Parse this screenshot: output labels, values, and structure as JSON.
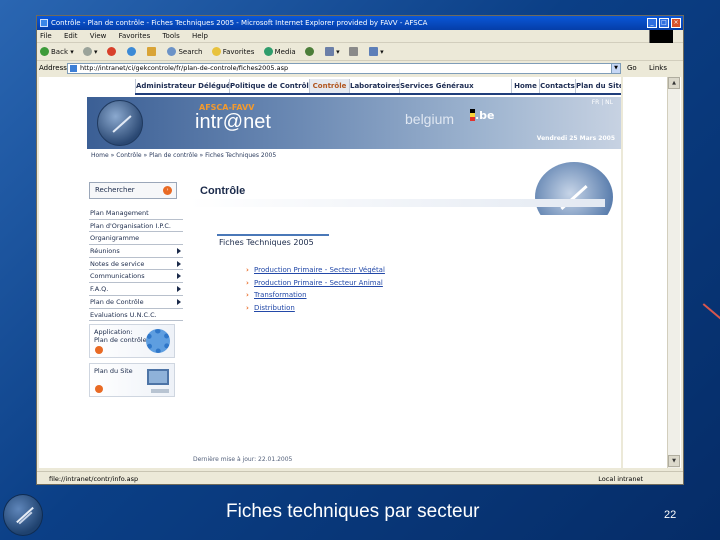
{
  "window": {
    "title": "Contrôle - Plan de contrôle - Fiches Techniques 2005 - Microsoft Internet Explorer provided by FAVV - AFSCA",
    "menu": [
      "File",
      "Edit",
      "View",
      "Favorites",
      "Tools",
      "Help"
    ],
    "toolbar": {
      "back": "Back",
      "search": "Search",
      "favorites": "Favorites",
      "media": "Media"
    },
    "address_label": "Address",
    "address_value": "http://intranet/ci/gekcontrole/fr/plan-de-controle/fiches2005.asp",
    "go_label": "Go",
    "links_label": "Links",
    "status_text": "file://intranet/contr/info.asp",
    "status_zone": "Local intranet"
  },
  "site": {
    "topnav": [
      "Administrateur Délégué",
      "Politique de Contrôle",
      "Contrôle",
      "Laboratoires",
      "Services Généraux",
      "Home",
      "Contacts",
      "Plan du Site"
    ],
    "active_nav": "Contrôle",
    "lang": "FR | NL",
    "agency": "AFSCA-FAVV",
    "brand": "intr@net",
    "country": "belgium",
    "country_tld": ".be",
    "date": "Vendredi 25 Mars 2005",
    "breadcrumb": "Home » Contrôle » Plan de contrôle » Fiches Techniques 2005",
    "search_label": "Rechercher",
    "sidebar": [
      {
        "label": "Plan Management",
        "arrow": false
      },
      {
        "label": "Plan d'Organisation I.P.C.",
        "arrow": false
      },
      {
        "label": "Organigramme",
        "arrow": false
      },
      {
        "label": "Réunions",
        "arrow": true
      },
      {
        "label": "Notes de service",
        "arrow": true
      },
      {
        "label": "Communications",
        "arrow": true
      },
      {
        "label": "F.A.Q.",
        "arrow": true
      },
      {
        "label": "Plan de Contrôle",
        "arrow": true
      },
      {
        "label": "Evaluations U.N.C.C.",
        "arrow": false
      }
    ],
    "tile_application": "Application:\nPlan de contrôle",
    "tile_sitemap": "Plan du Site",
    "page_title": "Contrôle",
    "section_title": "Fiches Techniques 2005",
    "links": [
      "Production Primaire - Secteur Végétal",
      "Production Primaire - Secteur Animal",
      "Transformation",
      "Distribution"
    ],
    "footer": "Dernière mise à jour: 22.01.2005"
  },
  "slide": {
    "caption": "Fiches techniques par secteur",
    "number": "22"
  },
  "colors": {
    "slide_bg": "#0b3f86",
    "titlebar": "#0a57d8",
    "accent_orange": "#e96a24",
    "link": "#2349a8",
    "nav_text": "#1d2c52"
  }
}
